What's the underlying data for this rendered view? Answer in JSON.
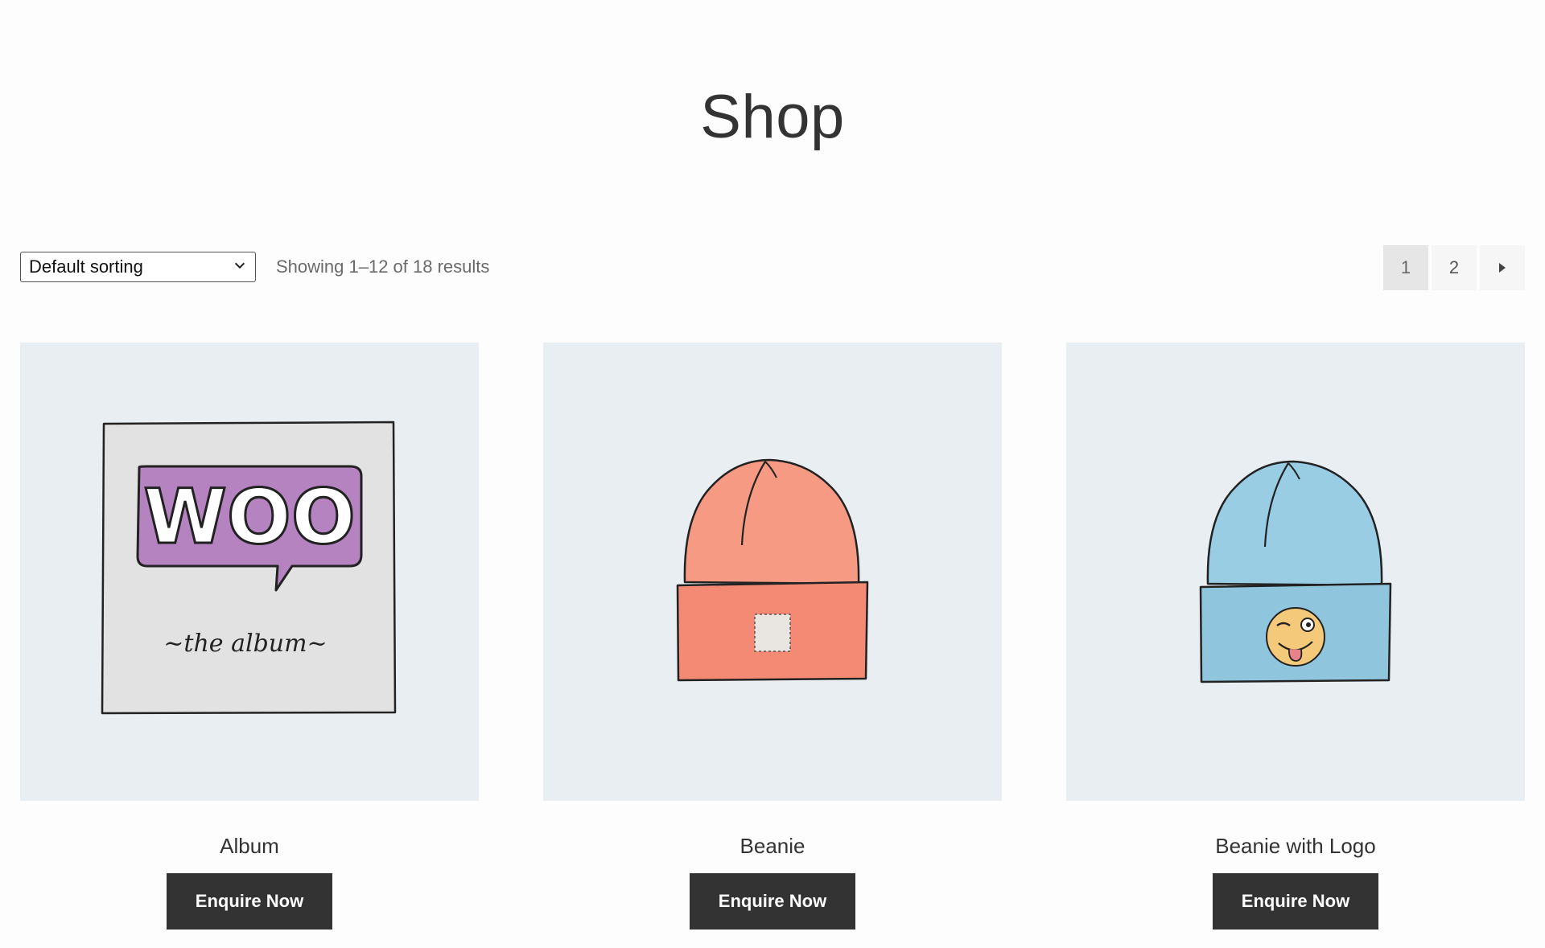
{
  "page": {
    "title": "Shop"
  },
  "toolbar": {
    "sort_value": "Default sorting",
    "result_count": "Showing 1–12 of 18 results"
  },
  "pagination": {
    "pages": [
      "1",
      "2"
    ],
    "current": "1",
    "next_icon": "triangle-right-icon"
  },
  "products": [
    {
      "name": "Album",
      "button": "Enquire Now",
      "image": "album-woo-illustration"
    },
    {
      "name": "Beanie",
      "button": "Enquire Now",
      "image": "orange-beanie-illustration"
    },
    {
      "name": "Beanie with Logo",
      "button": "Enquire Now",
      "image": "blue-beanie-with-emoji-illustration"
    }
  ],
  "album_art": {
    "logo_text": "WOO",
    "caption": "~the album~"
  },
  "colors": {
    "button_bg": "#333333",
    "thumb_bg": "#e8eef2",
    "orange_beanie": "#f58a74",
    "blue_beanie": "#8fc5dd",
    "woo_purple": "#b583c0"
  }
}
